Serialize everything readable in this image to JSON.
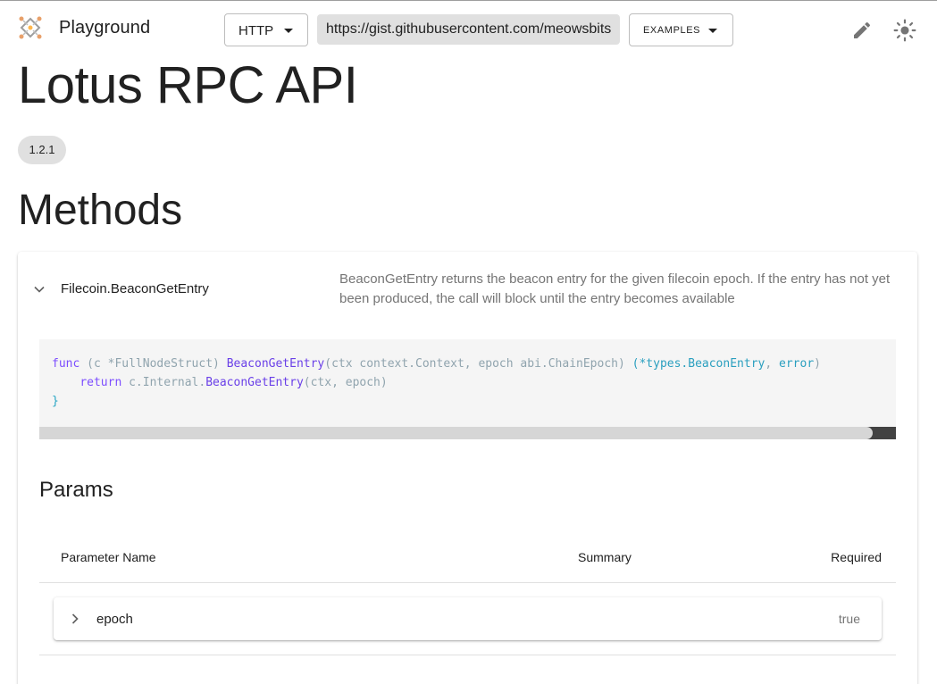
{
  "header": {
    "app_title": "Playground",
    "transport": "HTTP",
    "url": "https://gist.githubusercontent.com/meowsbits",
    "examples_label": "EXAMPLES"
  },
  "api": {
    "title": "Lotus RPC API",
    "version": "1.2.1"
  },
  "methods": {
    "heading": "Methods",
    "items": [
      {
        "name": "Filecoin.BeaconGetEntry",
        "description": "BeaconGetEntry returns the beacon entry for the given filecoin epoch. If the entry has not yet been produced, the call will block until the entry becomes available",
        "code": {
          "line1": {
            "kw": "func",
            "recv_open": " (c ",
            "recv_type": "*FullNodeStruct",
            "recv_close": ") ",
            "fn": "BeaconGetEntry",
            "args": "(ctx context.Context, epoch abi.ChainEpoch) ",
            "ret_open": "(",
            "ret_type": "*types.BeaconEntry",
            "ret_sep": ", ",
            "ret_err": "error",
            "ret_close": ")"
          },
          "line2": {
            "indent": "    ",
            "kw": "return",
            "pre": " c.Internal.",
            "fn": "BeaconGetEntry",
            "args": "(ctx, epoch)"
          },
          "line3": "}"
        },
        "params": {
          "heading": "Params",
          "columns": {
            "name": "Parameter Name",
            "summary": "Summary",
            "required": "Required"
          },
          "rows": [
            {
              "name": "epoch",
              "summary": "",
              "required": "true"
            }
          ]
        }
      }
    ]
  },
  "icons": {
    "logo": "playground-logo-icon",
    "edit": "pencil-icon",
    "theme": "sun-icon",
    "expand": "chevron-down-icon",
    "row_expand": "chevron-right-icon"
  }
}
